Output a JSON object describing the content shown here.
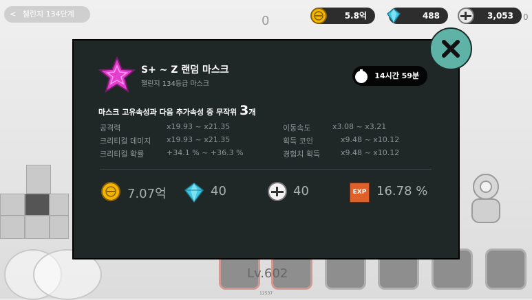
{
  "top": {
    "back_label": "챌린지 134단계",
    "counter": "0",
    "side_counter": "0",
    "gold": "5.8억",
    "gems": "488",
    "bolts": "3,053"
  },
  "modal": {
    "title": "S+ ~ Z 랜덤 마스크",
    "subtitle": "챌린지 134등급 마스크",
    "timer": "14시간 59분",
    "desc_prefix": "마스크 고유속성과 다음 추가속성 중 무작위 ",
    "desc_count": "3",
    "desc_suffix": "개",
    "stats_left": [
      {
        "label": "공격력",
        "value": "x19.93 ~ x21.35"
      },
      {
        "label": "크리티컬 데미지",
        "value": "x19.93 ~ x21.35"
      },
      {
        "label": "크리티컬 확률",
        "value": "+34.1 % ~ +36.3 %"
      }
    ],
    "stats_right": [
      {
        "label": "이동속도",
        "value": "x3.08 ~ x3.21"
      },
      {
        "label": "획득 코인",
        "value": "x9.48 ~ x10.12"
      },
      {
        "label": "경험치 획득",
        "value": "x9.48 ~ x10.12"
      }
    ],
    "rewards": {
      "gold": "7.07억",
      "gems": "40",
      "bolts": "40",
      "exp": "16.78 %",
      "exp_badge": "EXP"
    }
  },
  "bottom": {
    "level": "Lv.602",
    "tiny_number": "12537"
  },
  "colors": {
    "modal_bg": "#1f2727",
    "close_bg": "#5fb3a6",
    "star": "#e33fcf",
    "gold": "#f2b500",
    "gem": "#3ec8e6",
    "exp": "#e0602a"
  }
}
